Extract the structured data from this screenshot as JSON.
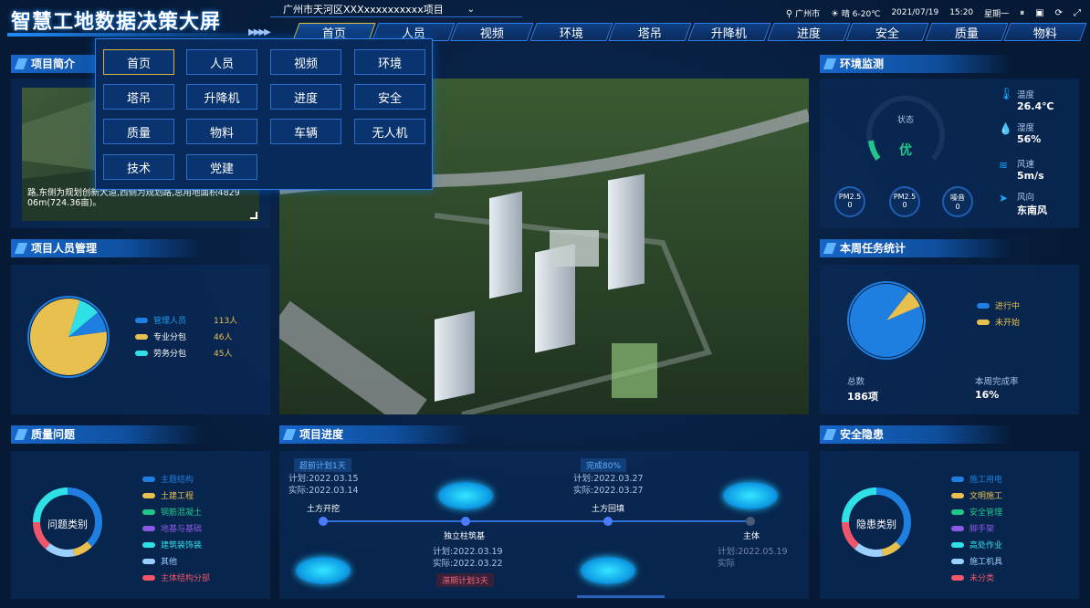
{
  "header": {
    "title": "智慧工地数据决策大屏",
    "project_select": "广州市天河区XXXxxxxxxxxxx项目",
    "city": "广州市",
    "weather": "晴 6-20℃",
    "date": "2021/07/19",
    "time": "15:20",
    "weekday": "星期一"
  },
  "nav_tabs": [
    "首页",
    "人员",
    "视频",
    "环境",
    "塔吊",
    "升降机",
    "进度",
    "安全",
    "质量",
    "物料"
  ],
  "dropdown_items": [
    "首页",
    "人员",
    "视频",
    "环境",
    "塔吊",
    "升降机",
    "进度",
    "安全",
    "质量",
    "物料",
    "车辆",
    "无人机",
    "技术",
    "党建"
  ],
  "project_intro": {
    "title": "项目简介",
    "text_line1": "路,东侧为规划创新大道,西侧为规划路,总用地面积4829",
    "text_line2": "06m(724.36亩)。"
  },
  "personnel": {
    "title": "项目人员管理",
    "legend": [
      {
        "label": "管理人员",
        "value": "113人",
        "color": "#1e7fe0"
      },
      {
        "label": "专业分包",
        "value": "46人",
        "color": "#e8c050"
      },
      {
        "label": "劳务分包",
        "value": "45人",
        "color": "#2fe0e6"
      }
    ]
  },
  "chart_data": [
    {
      "type": "pie",
      "categories": [
        "管理人员",
        "专业分包",
        "劳务分包"
      ],
      "values": [
        113,
        46,
        45
      ],
      "display_fractions": [
        0.09,
        0.82,
        0.09
      ]
    },
    {
      "type": "pie",
      "categories": [
        "进行中",
        "未开始"
      ],
      "values": [
        0.92,
        0.08
      ]
    }
  ],
  "environment": {
    "title": "环境监测",
    "status_label": "状态",
    "status_value": "优",
    "temp_label": "温度",
    "temp_value": "26.4℃",
    "hum_label": "湿度",
    "hum_value": "56%",
    "wind_label": "风速",
    "wind_value": "5m/s",
    "dir_label": "风向",
    "dir_value": "东南风",
    "metrics": [
      {
        "label": "PM2.5",
        "value": "0"
      },
      {
        "label": "PM2.5",
        "value": "0"
      },
      {
        "label": "噪音",
        "value": "0"
      }
    ]
  },
  "weekly": {
    "title": "本周任务统计",
    "legend": [
      {
        "label": "进行中",
        "color": "#1e7fe0"
      },
      {
        "label": "未开始",
        "color": "#e8c050"
      }
    ],
    "total_label": "总数",
    "total_value": "186项",
    "rate_label": "本周完成率",
    "rate_value": "16%"
  },
  "quality": {
    "title": "质量问题",
    "center": "问题类别",
    "legend": [
      {
        "label": "主题结构",
        "color": "#1e7fe0"
      },
      {
        "label": "土建工程",
        "color": "#e8c050"
      },
      {
        "label": "钢筋混凝土",
        "color": "#21c78a"
      },
      {
        "label": "地基与基础",
        "color": "#8a5ae6"
      },
      {
        "label": "建筑装饰装",
        "color": "#2fe0e6"
      },
      {
        "label": "其他",
        "color": "#9ad0ff"
      },
      {
        "label": "主体结构分部",
        "color": "#f0566a"
      }
    ]
  },
  "progress": {
    "title": "项目进度",
    "badge_ahead": "超前计划1天",
    "badge_done": "完成80%",
    "badge_delay": "滞期计划3天",
    "n1_plan": "计划:2022.03.15",
    "n1_actual": "实际:2022.03.14",
    "n1_name": "土方开挖",
    "n2_name": "独立柱筑基",
    "n2_plan": "计划:2022.03.19",
    "n2_actual": "实际:2022.03.22",
    "n3_plan": "计划:2022.03.27",
    "n3_actual": "实际:2022.03.27",
    "n3_name": "土方回填",
    "n4_name": "主体",
    "n4_plan": "计划:2022.05.19",
    "n4_actual": "实际"
  },
  "safety": {
    "title": "安全隐患",
    "center": "隐患类别",
    "legend": [
      {
        "label": "施工用电",
        "color": "#1e7fe0"
      },
      {
        "label": "文明施工",
        "color": "#e8c050"
      },
      {
        "label": "安全管理",
        "color": "#21c78a"
      },
      {
        "label": "脚手架",
        "color": "#8a5ae6"
      },
      {
        "label": "高处作业",
        "color": "#2fe0e6"
      },
      {
        "label": "施工机具",
        "color": "#9ad0ff"
      },
      {
        "label": "未分类",
        "color": "#f0566a"
      }
    ]
  }
}
